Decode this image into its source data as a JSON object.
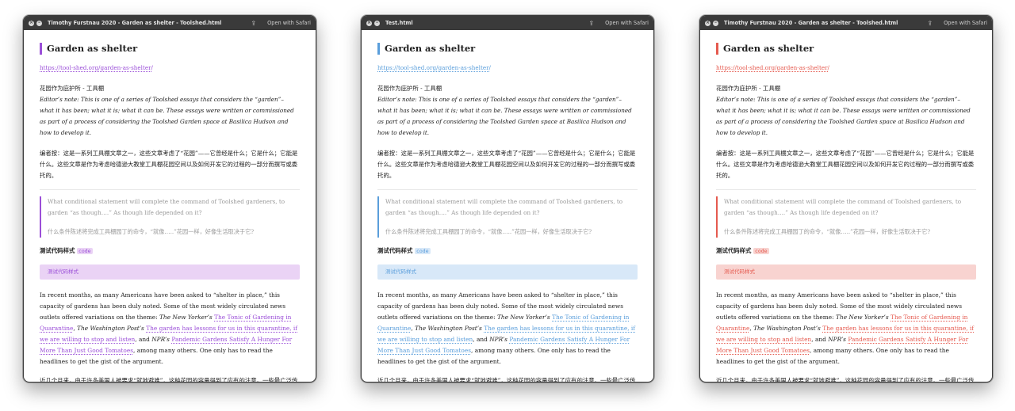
{
  "windows": [
    {
      "theme": "purple",
      "title": "Timothy Furstnau 2020 - Garden as shelter - Toolshed.html"
    },
    {
      "theme": "blue",
      "title": "Test.html"
    },
    {
      "theme": "red",
      "title": "Timothy Furstnau 2020 - Garden as shelter - Toolshed.html"
    }
  ],
  "titlebar": {
    "open_with": "Open with Safari",
    "close_glyph": "×",
    "minimize_glyph": "–",
    "share_glyph": "⇪"
  },
  "doc": {
    "heading": "Garden as shelter",
    "url": "https://tool-shed.org/garden-as-shelter/",
    "cn_heading": "花园作为庇护所 - 工具棚",
    "editor_note": "Editor’s note: This is one of a series of Toolshed essays that considers the “garden”– what it has been; what it is; what it can be. These essays were written or commissioned as part of a process of considering the Toolshed Garden space at Basilica Hudson and how to develop it.",
    "cn_note": "编者按：这是一系列工具棚文章之一，这些文章考虑了“花园”——它曾经是什么；它是什么；它能是什么。这些文章是作为考虑哈德逊大教堂工具棚花园空间以及如何开发它的过程的一部分而撰写或委托的。",
    "quote_en": "What conditional statement will complete the command of Toolshed gardeners, to garden “as though….” As though life depended on it?",
    "quote_cn": "什么条件陈述将完成工具棚园丁的命令，“就像…..”花园一样，好像生活取决于它?",
    "code_label": "测试代码样式",
    "code_inline": "code",
    "code_block": "测试代码样式",
    "para1": {
      "t1": "In recent months, as many Americans have been asked to “shelter in place,” this capacity of gardens has been duly noted. Some of the most widely circulated news outlets offered variations on the theme: ",
      "src1": "The New Yorker’s",
      "link1": "The Tonic of Gardening in Quarantine",
      "t2": ", ",
      "src2": "The Washington Post’s",
      "link2": "The garden has lessons for us in this quarantine, if we are willing to stop and listen",
      "t3": ", and ",
      "src3": "NPR’s",
      "link3": "Pandemic Gardens Satisfy A Hunger For More Than Just Good Tomatoes",
      "t4": ", among many others. One only has to read the headlines to get the gist of the argument."
    },
    "para_cn": "近几个月来，由于许多美国人被要求“就地避难”，这种花园的容量得到了应有的注意。一些最广泛传播的新闻媒体提供了关于这个主题的变体：《纽约客》的《隔离园艺补品》，《华盛顿邮"
  }
}
